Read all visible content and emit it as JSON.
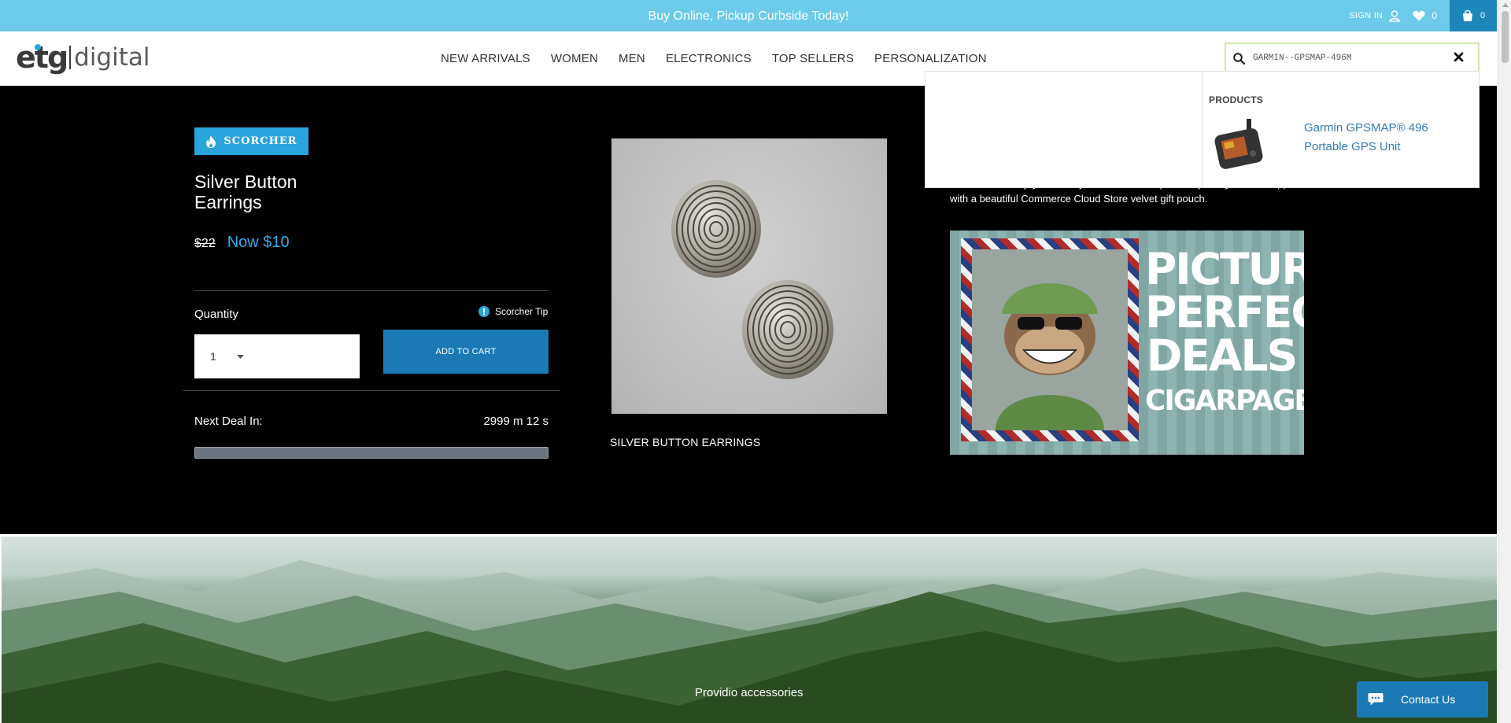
{
  "promo": {
    "text": "Buy Online, Pickup Curbside Today!"
  },
  "account": {
    "signin_label": "SIGN IN",
    "wishlist_count": "0",
    "cart_count": "0"
  },
  "logo": {
    "brand": "etg",
    "suffix": "digital"
  },
  "nav": {
    "items": [
      {
        "label": "NEW ARRIVALS"
      },
      {
        "label": "WOMEN"
      },
      {
        "label": "MEN"
      },
      {
        "label": "ELECTRONICS"
      },
      {
        "label": "TOP SELLERS"
      },
      {
        "label": "PERSONALIZATION"
      }
    ]
  },
  "search": {
    "value": "GARMIN--GPSMAP-496M",
    "placeholder": ""
  },
  "dropdown": {
    "heading": "PRODUCTS",
    "product_line1": "Garmin GPSMAP® 496",
    "product_line2": "Portable GPS Unit"
  },
  "deal": {
    "badge": "SCORCHER",
    "title": "Silver Button Earrings",
    "old_price": "$22",
    "new_price": "Now $10",
    "quantity_label": "Quantity",
    "tip_label": "Scorcher Tip",
    "quantity_value": "1",
    "add_to_cart": "ADD TO CART",
    "next_deal_label": "Next Deal In:",
    "countdown": "2999 m 12 s",
    "product_caption": "SILVER BUTTON EARRINGS",
    "description": "necklace and enjoy them all year round. Each piece of jewelry will be shipped with a beautiful Commerce Cloud Store velvet gift pouch."
  },
  "ad": {
    "line1": "PICTURE",
    "line2": "PERFECT",
    "line3": "DEALS",
    "url": "CIGARPAGE.COM"
  },
  "scenic": {
    "caption": "Providio accessories"
  },
  "contact": {
    "label": "Contact Us"
  },
  "colors": {
    "accent": "#29a4dd",
    "promo": "#6ccbeb",
    "button": "#1b7ab5"
  }
}
